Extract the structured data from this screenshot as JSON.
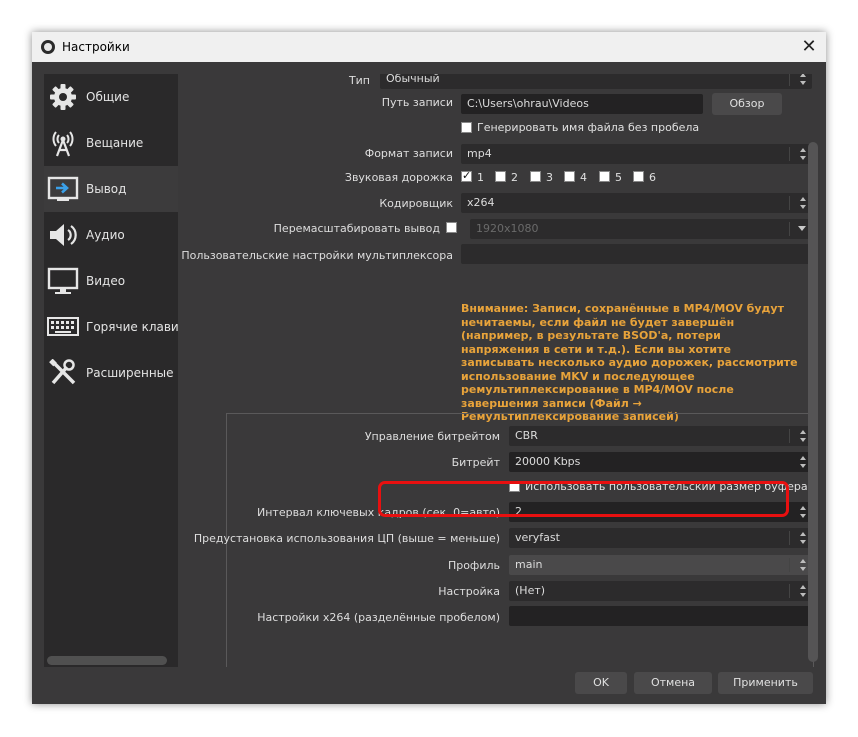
{
  "window": {
    "title": "Настройки"
  },
  "sidebar": {
    "items": [
      {
        "label": "Общие",
        "icon": "gear-icon"
      },
      {
        "label": "Вещание",
        "icon": "broadcast-icon"
      },
      {
        "label": "Вывод",
        "icon": "output-icon"
      },
      {
        "label": "Аудио",
        "icon": "speaker-icon"
      },
      {
        "label": "Видео",
        "icon": "monitor-icon"
      },
      {
        "label": "Горячие клавиш",
        "icon": "keyboard-icon"
      },
      {
        "label": "Расширенные",
        "icon": "tools-icon"
      }
    ],
    "active_index": 2
  },
  "recording": {
    "type_label": "Тип",
    "type_value": "Обычный",
    "path_label": "Путь записи",
    "path_value": "C:\\Users\\ohrau\\Videos",
    "browse_label": "Обзор",
    "no_space_label": "Генерировать имя файла без пробела",
    "no_space_checked": false,
    "format_label": "Формат записи",
    "format_value": "mp4",
    "tracks_label": "Звуковая дорожка",
    "tracks": [
      {
        "label": "1",
        "checked": true
      },
      {
        "label": "2",
        "checked": false
      },
      {
        "label": "3",
        "checked": false
      },
      {
        "label": "4",
        "checked": false
      },
      {
        "label": "5",
        "checked": false
      },
      {
        "label": "6",
        "checked": false
      }
    ],
    "encoder_label": "Кодировщик",
    "encoder_value": "x264",
    "rescale_label": "Перемасштабировать вывод",
    "rescale_checked": false,
    "rescale_value": "1920x1080",
    "muxer_label": "Пользовательские настройки мультиплексора",
    "muxer_value": "",
    "warning": "Внимание: Записи, сохранённые в MP4/MOV будут нечитаемы, если файл не будет завершён (например, в результате BSOD'а, потери напряжения в сети и т.д.). Если вы хотите записывать несколько аудио дорожек, рассмотрите использование MKV и последующее ремультиплексирование в MP4/MOV после завершения записи (Файл → Ремультиплексирование записей)"
  },
  "encoder": {
    "rate_control_label": "Управление битрейтом",
    "rate_control_value": "CBR",
    "bitrate_label": "Битрейт",
    "bitrate_value": "20000 Kbps",
    "custom_buffer_label": "Использовать пользовательский размер буфера",
    "custom_buffer_checked": false,
    "keyframe_label": "Интервал ключевых кадров (сек, 0=авто)",
    "keyframe_value": "2",
    "preset_label": "Предустановка использования ЦП (выше = меньше)",
    "preset_value": "veryfast",
    "profile_label": "Профиль",
    "profile_value": "main",
    "tune_label": "Настройка",
    "tune_value": "(Нет)",
    "x264opts_label": "Настройки x264 (разделённые пробелом)",
    "x264opts_value": ""
  },
  "buttons": {
    "ok": "OK",
    "cancel": "Отмена",
    "apply": "Применить"
  },
  "colors": {
    "highlight": "#e81010",
    "warning_text": "#e8a33a",
    "window_bg": "#3a393a"
  }
}
